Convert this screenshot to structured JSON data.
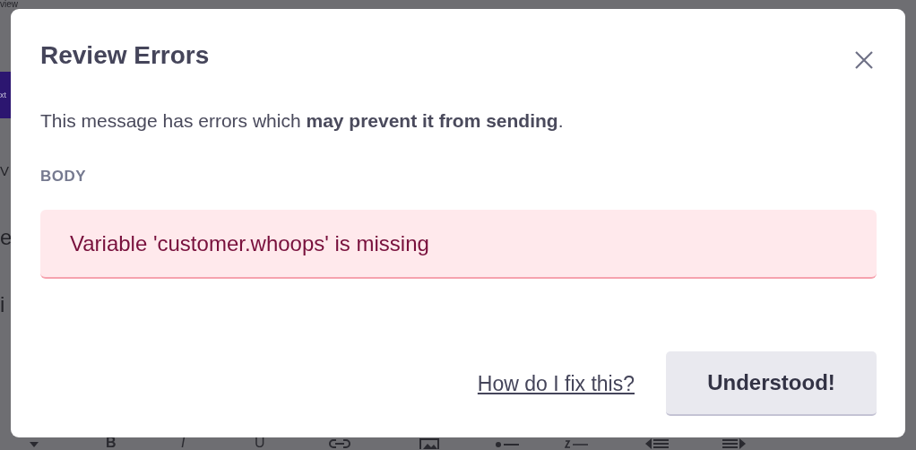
{
  "backdrop": {
    "fragments": [
      "view",
      "xt",
      "V",
      "e",
      "i"
    ],
    "toolbar": [
      "B",
      "I",
      "U"
    ]
  },
  "dialog": {
    "title": "Review Errors",
    "message": "This message has errors which **may prevent it from sending**.",
    "section_label": "BODY",
    "errors": [
      "Variable 'customer.whoops' is missing"
    ],
    "help_link": "How do I fix this?",
    "confirm_button": "Understood!"
  }
}
